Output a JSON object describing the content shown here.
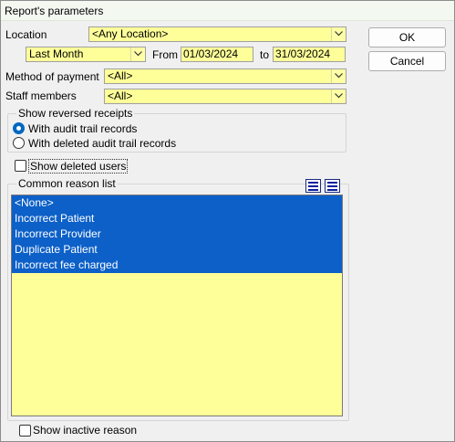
{
  "window": {
    "title": "Report's parameters"
  },
  "location": {
    "label": "Location",
    "value": "<Any Location>"
  },
  "period": {
    "value": "Last Month",
    "from_label": "From",
    "from_value": "01/03/2024",
    "to_label": "to",
    "to_value": "31/03/2024"
  },
  "payment": {
    "label": "Method of payment",
    "value": "<All>"
  },
  "staff": {
    "label": "Staff members",
    "value": "<All>"
  },
  "reversed": {
    "title": "Show reversed receipts",
    "options": [
      {
        "label": "With audit trail records",
        "selected": true
      },
      {
        "label": "With deleted audit trail records",
        "selected": false
      }
    ]
  },
  "show_deleted_users": {
    "label": "Show deleted users",
    "checked": false
  },
  "reasons": {
    "title": "Common reason list",
    "items": [
      {
        "label": "<None>",
        "selected": true
      },
      {
        "label": "Incorrect Patient",
        "selected": true
      },
      {
        "label": "Incorrect Provider",
        "selected": true
      },
      {
        "label": "Duplicate Patient",
        "selected": true
      },
      {
        "label": "Incorrect fee charged",
        "selected": true
      }
    ]
  },
  "show_inactive": {
    "label": "Show inactive reason",
    "checked": false
  },
  "buttons": {
    "ok": "OK",
    "cancel": "Cancel"
  },
  "icons": [
    "dropdown-arrow-icon",
    "select-all-icon",
    "deselect-all-icon"
  ],
  "colors": {
    "field_bg": "#ffff99",
    "selection": "#0c60c8",
    "radio_accent": "#0067c0"
  }
}
